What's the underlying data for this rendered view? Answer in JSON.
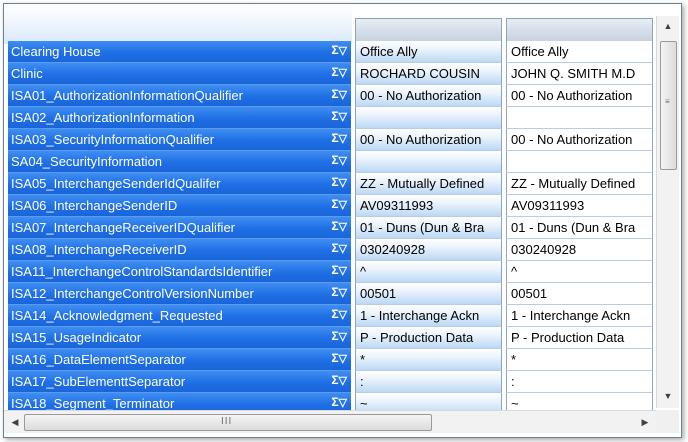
{
  "rows": [
    {
      "label": "Clearing House",
      "v1": "Office Ally",
      "v2": "Office Ally"
    },
    {
      "label": "Clinic",
      "v1": "ROCHARD COUSIN",
      "v2": "JOHN Q. SMITH M.D"
    },
    {
      "label": "ISA01_AuthorizationInformationQualifier",
      "v1": "00 - No Authorization",
      "v2": "00 - No Authorization"
    },
    {
      "label": "ISA02_AuthorizationInformation",
      "v1": "",
      "v2": ""
    },
    {
      "label": "ISA03_SecurityInformationQualifier",
      "v1": "00 - No Authorization",
      "v2": "00 - No Authorization"
    },
    {
      "label": "SA04_SecurityInformation",
      "v1": "",
      "v2": ""
    },
    {
      "label": "ISA05_InterchangeSenderIdQualifer",
      "v1": "ZZ - Mutually Defined",
      "v2": "ZZ - Mutually Defined"
    },
    {
      "label": "ISA06_InterchangeSenderID",
      "v1": "AV09311993",
      "v2": "AV09311993"
    },
    {
      "label": "ISA07_InterchangeReceiverIDQualifier",
      "v1": "01 - Duns (Dun & Bra",
      "v2": "01 - Duns (Dun & Bra"
    },
    {
      "label": "ISA08_InterchangeReceiverID",
      "v1": "030240928",
      "v2": "030240928"
    },
    {
      "label": "ISA11_InterchangeControlStandardsIdentifier",
      "v1": "^",
      "v2": "^"
    },
    {
      "label": "ISA12_InterchangeControlVersionNumber",
      "v1": "00501",
      "v2": "00501"
    },
    {
      "label": "ISA14_Acknowledgment_Requested",
      "v1": "1 - Interchange Ackn",
      "v2": "1 - Interchange Ackn"
    },
    {
      "label": "ISA15_UsageIndicator",
      "v1": "P - Production Data",
      "v2": "P - Production Data"
    },
    {
      "label": "ISA16_DataElementSeparator",
      "v1": "*",
      "v2": "*"
    },
    {
      "label": "ISA17_SubElementtSeparator",
      "v1": ":",
      "v2": ":"
    },
    {
      "label": "ISA18_Segment_Terminator",
      "v1": "~",
      "v2": "~"
    }
  ],
  "icons": {
    "sum": "Σ",
    "filter": "▽"
  },
  "scrollbars": {
    "up": "▲",
    "down": "▼",
    "left": "◀",
    "right": "▶",
    "grip_h": "III",
    "grip_v": "≡"
  }
}
